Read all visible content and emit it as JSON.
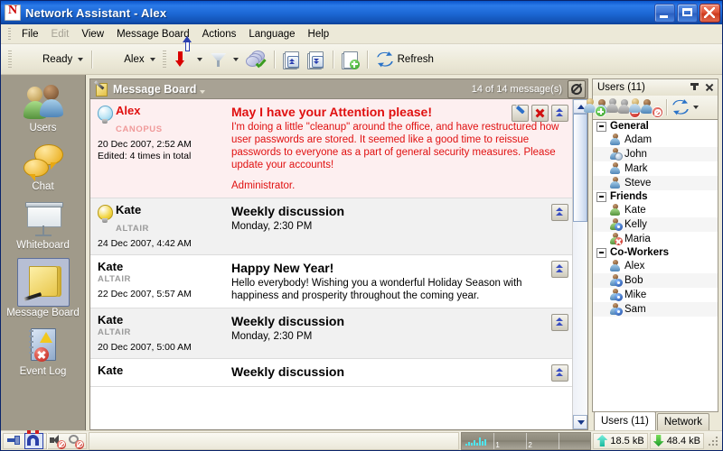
{
  "window": {
    "title": "Network Assistant - Alex",
    "app_icon": "app-logo-icon",
    "minimize": "Minimize",
    "maximize": "Maximize",
    "close": "Close"
  },
  "menubar": {
    "items": [
      {
        "label": "File",
        "disabled": false
      },
      {
        "label": "Edit",
        "disabled": true
      },
      {
        "label": "View",
        "disabled": false
      },
      {
        "label": "Message Board",
        "disabled": false
      },
      {
        "label": "Actions",
        "disabled": false
      },
      {
        "label": "Language",
        "disabled": false
      },
      {
        "label": "Help",
        "disabled": false
      }
    ]
  },
  "toolbar": {
    "status_label": "Ready",
    "user_label": "Alex",
    "refresh_label": "Refresh",
    "icons": {
      "status": "person-icon",
      "user": "person-name-icon",
      "sort": "sort-arrows-icon",
      "filter": "funnel-icon",
      "approve": "bubbles-check-icon",
      "collapse_all": "page-collapse-icon",
      "expand_all": "page-expand-icon",
      "new_message": "page-add-icon",
      "refresh": "refresh-icon"
    }
  },
  "sidebar": {
    "items": [
      {
        "label": "Users",
        "icon": "users-icon",
        "active": false
      },
      {
        "label": "Chat",
        "icon": "chat-icon",
        "active": false
      },
      {
        "label": "Whiteboard",
        "icon": "whiteboard-icon",
        "active": false
      },
      {
        "label": "Message Board",
        "icon": "message-board-icon",
        "active": true
      },
      {
        "label": "Event Log",
        "icon": "event-log-icon",
        "active": false
      }
    ]
  },
  "message_board": {
    "title": "Message Board",
    "count_text": "14 of 14 message(s)",
    "stop_icon": "stop-icon",
    "messages": [
      {
        "author": "Alex",
        "host": "CANOPUS",
        "date": "20 Dec 2007,  2:52 AM",
        "edited": "Edited: 4 times in total",
        "subject": "May I have your Attention please!",
        "text": "I'm doing a little \"cleanup\" around the office, and have restructured how user passwords are stored. It seemed like a good time to reissue passwords to everyone as a part of general security measures. Please update your accounts!",
        "signature": "Administrator.",
        "highlight": true,
        "bulb": "blue",
        "actions": [
          "edit-icon",
          "delete-icon",
          "collapse-icon"
        ]
      },
      {
        "author": "Kate",
        "host": "ALTAIR",
        "date": "24 Dec 2007,  4:42 AM",
        "edited": "",
        "subject": "Weekly discussion",
        "text": "Monday, 2:30 PM",
        "signature": "",
        "highlight": false,
        "bulb": "yellow",
        "actions": [
          "collapse-icon"
        ]
      },
      {
        "author": "Kate",
        "host": "ALTAIR",
        "date": "22 Dec 2007,  5:57 AM",
        "edited": "",
        "subject": "Happy New Year!",
        "text": "Hello everybody! Wishing you a wonderful Holiday Season with happiness and prosperity throughout the coming year.",
        "signature": "",
        "highlight": false,
        "bulb": "none",
        "actions": [
          "collapse-icon"
        ]
      },
      {
        "author": "Kate",
        "host": "ALTAIR",
        "date": "20 Dec 2007,  5:00 AM",
        "edited": "",
        "subject": "Weekly discussion",
        "text": "Monday, 2:30 PM",
        "signature": "",
        "highlight": false,
        "bulb": "none",
        "actions": [
          "collapse-icon"
        ]
      },
      {
        "author": "Kate",
        "host": "",
        "date": "",
        "edited": "",
        "subject": "Weekly discussion",
        "text": "",
        "signature": "",
        "highlight": false,
        "bulb": "none",
        "actions": [
          "collapse-icon"
        ]
      }
    ]
  },
  "users_panel": {
    "header": "Users (11)",
    "pin_icon": "pin-icon",
    "close_icon": "close-icon",
    "toolbar_icons": [
      "add-user-icon",
      "remove-user-icon",
      "block-user-icon",
      "refresh-icon",
      "dropdown-caret-icon"
    ],
    "groups": [
      {
        "name": "General",
        "users": [
          {
            "name": "Adam",
            "status": "online"
          },
          {
            "name": "John",
            "status": "away"
          },
          {
            "name": "Mark",
            "status": "online"
          },
          {
            "name": "Steve",
            "status": "online"
          }
        ]
      },
      {
        "name": "Friends",
        "users": [
          {
            "name": "Kate",
            "status": "online"
          },
          {
            "name": "Kelly",
            "status": "busy"
          },
          {
            "name": "Maria",
            "status": "offline"
          }
        ]
      },
      {
        "name": "Co-Workers",
        "users": [
          {
            "name": "Alex",
            "status": "online"
          },
          {
            "name": "Bob",
            "status": "busy"
          },
          {
            "name": "Mike",
            "status": "busy"
          },
          {
            "name": "Sam",
            "status": "busy"
          }
        ]
      }
    ],
    "tabs": [
      {
        "label": "Users (11)",
        "active": true
      },
      {
        "label": "Network",
        "active": false
      }
    ]
  },
  "statusbar": {
    "icons": [
      "connect-icon",
      "magnet-icon",
      "sound-muted-icon",
      "alerts-muted-icon"
    ],
    "message": "",
    "graph_ticks": [
      "1",
      "2"
    ],
    "upload": "18.5 kB",
    "download": "48.4 kB",
    "upload_icon": "upload-arrow-icon",
    "download_icon": "download-arrow-icon"
  }
}
